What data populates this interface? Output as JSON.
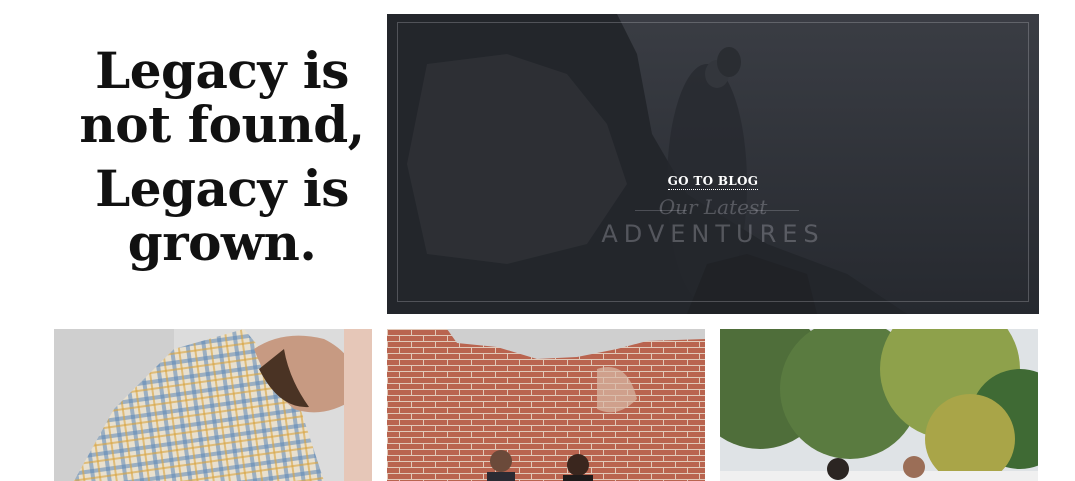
{
  "quote": {
    "line1": "Legacy is",
    "line2": "not found,",
    "line3": "Legacy is",
    "line4": "grown."
  },
  "hero": {
    "cta_label": "GO TO BLOG",
    "script_text": "Our Latest",
    "title_text": "ADVENTURES"
  },
  "colors": {
    "hero_overlay": "#2b2e34",
    "text": "#111111"
  }
}
